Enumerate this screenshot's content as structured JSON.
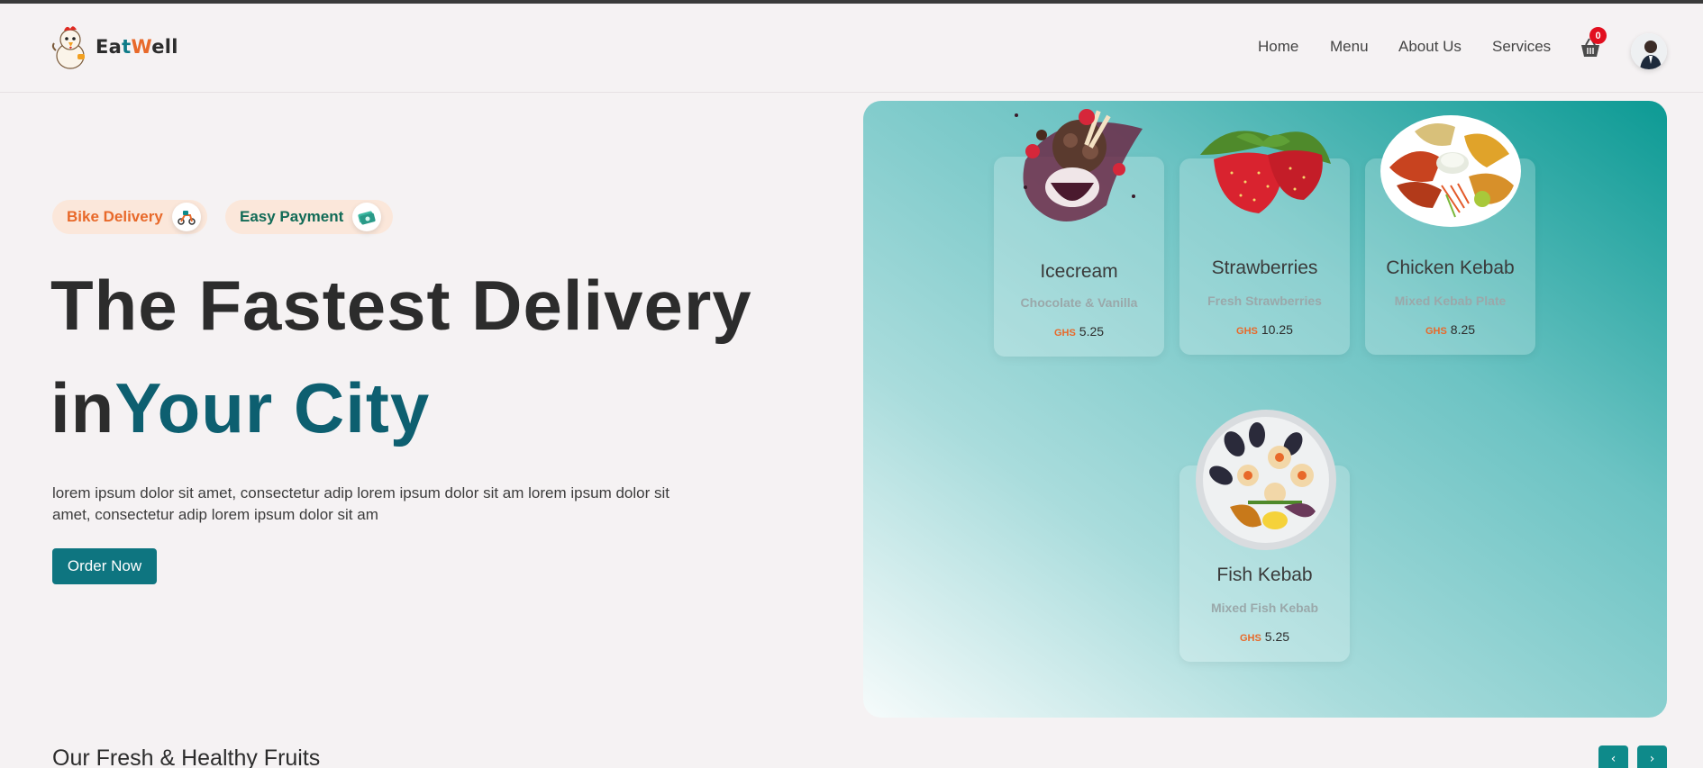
{
  "brand": {
    "part1": "Ea",
    "part2": "t",
    "part3": "W",
    "part4": "ell"
  },
  "nav": {
    "home": "Home",
    "menu": "Menu",
    "about": "About Us",
    "services": "Services"
  },
  "cart": {
    "count": "0",
    "icon": "basket-icon"
  },
  "badges": {
    "bike": "Bike Delivery",
    "payment": "Easy Payment"
  },
  "hero": {
    "line1": "The Fastest Delivery",
    "line2_plain": "in",
    "line2_accent": "Your City",
    "description": "lorem ipsum dolor sit amet, consectetur adip lorem ipsum dolor sit am lorem ipsum dolor sit amet, consectetur adip lorem ipsum dolor sit am",
    "cta": "Order Now"
  },
  "foods": [
    {
      "name": "Icecream",
      "subtitle": "Chocolate & Vanilla",
      "currency": "GHS",
      "price": "5.25"
    },
    {
      "name": "Strawberries",
      "subtitle": "Fresh Strawberries",
      "currency": "GHS",
      "price": "10.25"
    },
    {
      "name": "Chicken Kebab",
      "subtitle": "Mixed Kebab Plate",
      "currency": "GHS",
      "price": "8.25"
    },
    {
      "name": "Fish Kebab",
      "subtitle": "Mixed Fish Kebab",
      "currency": "GHS",
      "price": "5.25"
    }
  ],
  "fruits_section": {
    "title": "Our Fresh & Healthy Fruits",
    "prev": "‹",
    "next": "›"
  },
  "colors": {
    "accent_teal": "#0e7580",
    "accent_orange": "#e8692a",
    "badge_red": "#e20f1f"
  }
}
